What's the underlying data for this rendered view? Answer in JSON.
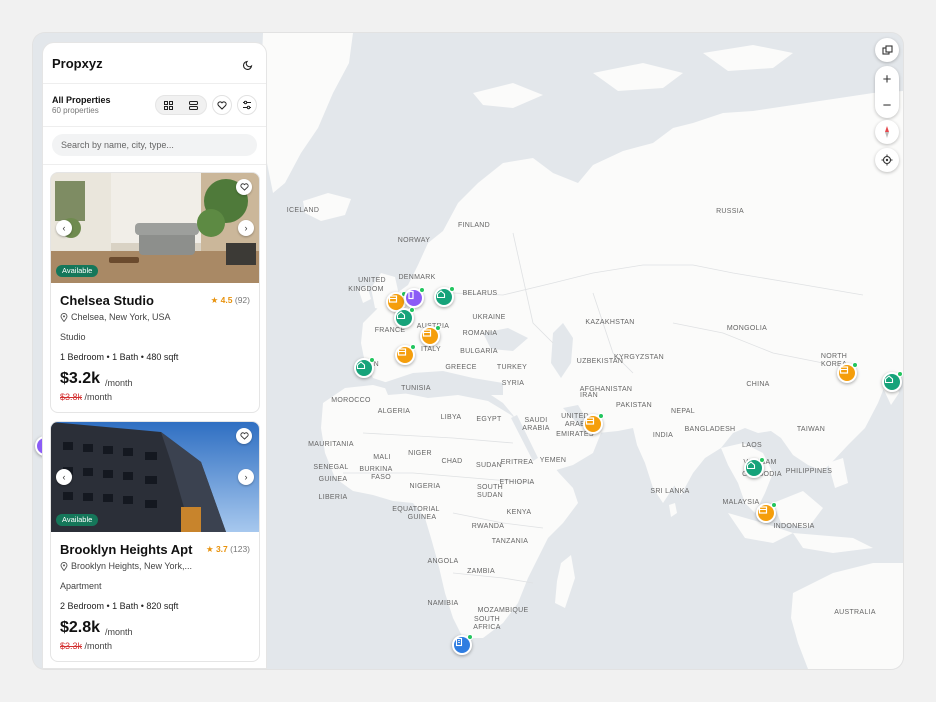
{
  "app": {
    "name": "Propxyz"
  },
  "listing": {
    "heading": "All Properties",
    "count": "60 properties"
  },
  "search": {
    "placeholder": "Search by name, city, type..."
  },
  "colors": {
    "green": "#16a37a",
    "orange": "#f59e0b",
    "purple": "#8b5cf6",
    "blue": "#2f7de1",
    "badge": "#15775a",
    "star": "#e8920c",
    "strike": "#d32f2f"
  },
  "properties": [
    {
      "title": "Chelsea Studio",
      "rating": "4.5",
      "reviews": "(92)",
      "location": "Chelsea, New York, USA",
      "type": "Studio",
      "specs": "1 Bedroom • 1 Bath • 480 sqft",
      "price": "$3.2k",
      "per": "/month",
      "old_price": "$3.8k",
      "old_per": "/month",
      "status": "Available"
    },
    {
      "title": "Brooklyn Heights Apt",
      "rating": "3.7",
      "reviews": "(123)",
      "location": "Brooklyn Heights, New York,...",
      "type": "Apartment",
      "specs": "2 Bedroom • 1 Bath • 820 sqft",
      "price": "$2.8k",
      "per": "/month",
      "old_price": "$3.3k",
      "old_per": "/month",
      "status": "Available"
    }
  ],
  "map": {
    "labels": [
      "RUSSIA",
      "ICELAND",
      "NORWAY",
      "FINLAND",
      "UNITED",
      "KINGDOM",
      "DENMARK",
      "BELARUS",
      "UKRAINE",
      "KAZAKHSTAN",
      "MONGOLIA",
      "FRANCE",
      "AUSTRIA",
      "ROMANIA",
      "BULGARIA",
      "ITALY",
      "GREECE",
      "TURKEY",
      "UZBEKISTAN",
      "KYRGYZSTAN",
      "NORTH",
      "KOREA",
      "SPAIN",
      "TUNISIA",
      "SYRIA",
      "IRAN",
      "AFGHANISTAN",
      "CHINA",
      "MOROCCO",
      "ALGERIA",
      "LIBYA",
      "EGYPT",
      "PAKISTAN",
      "NEPAL",
      "SAUDI",
      "ARABIA",
      "UNITED",
      "ARAB",
      "EMIRATES",
      "INDIA",
      "BANGLADESH",
      "TAIWAN",
      "LAOS",
      "MAURITANIA",
      "MALI",
      "NIGER",
      "CHAD",
      "SUDAN",
      "ERITREA",
      "YEMEN",
      "VIETNAM",
      "CAMBODIA",
      "PHILIPPINES",
      "SENEGAL",
      "GUINEA",
      "BURKINA",
      "FASO",
      "NIGERIA",
      "ETHIOPIA",
      "SOUTH",
      "SUDAN",
      "SRI LANKA",
      "LIBERIA",
      "EQUATORIAL",
      "GUINEA",
      "MALAYSIA",
      "KENYA",
      "RWANDA",
      "INDONESIA",
      "TANZANIA",
      "ANGOLA",
      "ZAMBIA",
      "NAMIBIA",
      "MOZAMBIQUE",
      "SOUTH",
      "AFRICA",
      "AUSTRALIA"
    ]
  }
}
